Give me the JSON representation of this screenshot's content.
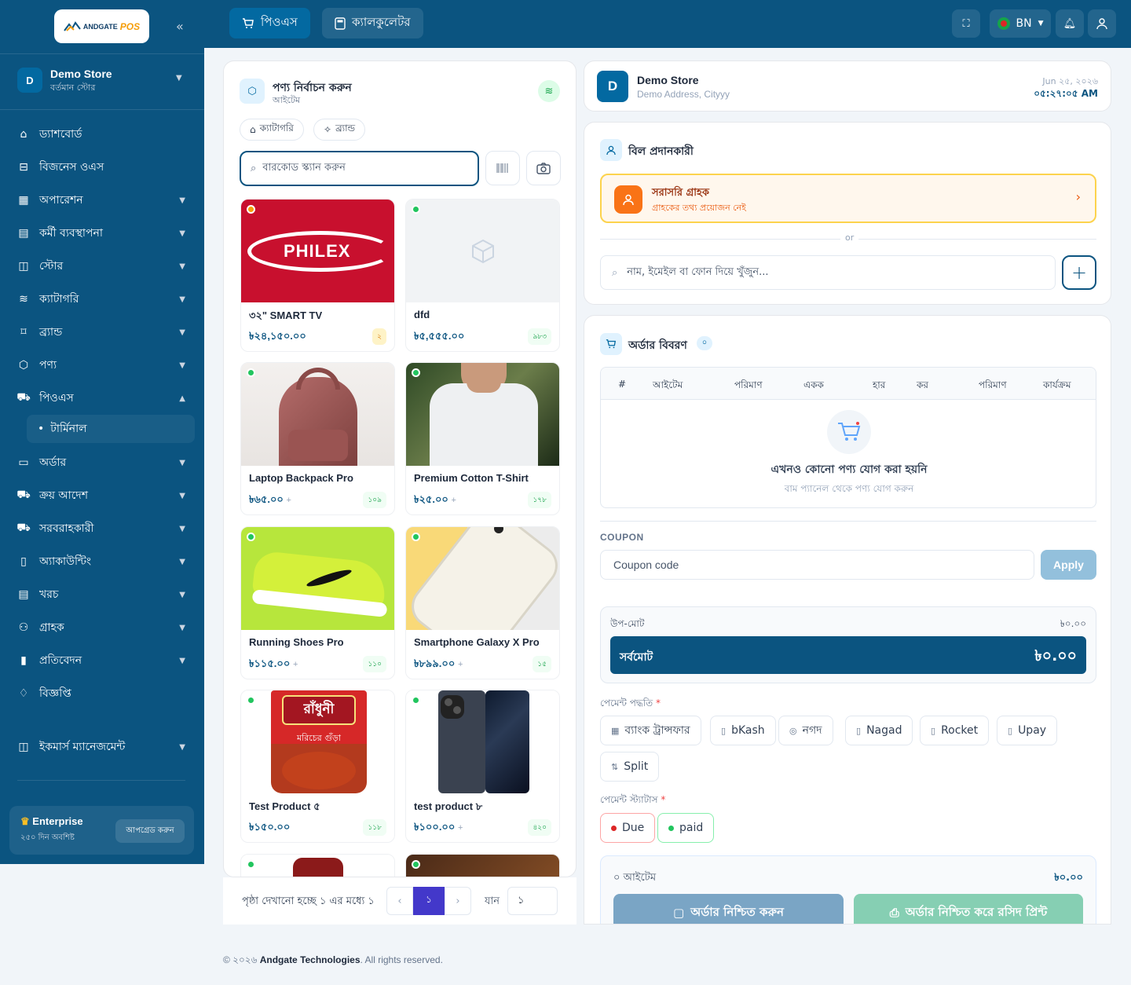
{
  "brand": {
    "logo_text": "ANDGATE",
    "logo_pos": "POS"
  },
  "store": {
    "avatar": "D",
    "name": "Demo Store",
    "sub": "বর্তমান স্টোর"
  },
  "nav": [
    {
      "label": "ড্যাশবোর্ড",
      "icon": "home-icon",
      "chev": false
    },
    {
      "label": "বিজনেস ওএস",
      "icon": "inbox-icon",
      "chev": false
    },
    {
      "label": "অপারেশন",
      "icon": "calculator-icon",
      "chev": true
    },
    {
      "label": "কর্মী ব্যবস্থাপনা",
      "icon": "calendar-icon",
      "chev": true
    },
    {
      "label": "স্টোর",
      "icon": "bag-icon",
      "chev": true
    },
    {
      "label": "ক্যাটাগরি",
      "icon": "layers-icon",
      "chev": true
    },
    {
      "label": "ব্র্যান্ড",
      "icon": "tag-icon",
      "chev": true
    },
    {
      "label": "পণ্য",
      "icon": "box-icon",
      "chev": true
    },
    {
      "label": "পিওএস",
      "icon": "cart-icon",
      "chev": true,
      "open": true
    },
    {
      "label": "টার্মিনাল",
      "sub": true
    },
    {
      "label": "অর্ডার",
      "icon": "document-icon",
      "chev": true
    },
    {
      "label": "ক্রয় আদেশ",
      "icon": "cart-icon",
      "chev": true
    },
    {
      "label": "সরবরাহকারী",
      "icon": "truck-icon",
      "chev": true
    },
    {
      "label": "অ্যাকাউন্টিং",
      "icon": "book-icon",
      "chev": true
    },
    {
      "label": "খরচ",
      "icon": "receipt-icon",
      "chev": true
    },
    {
      "label": "গ্রাহক",
      "icon": "users-icon",
      "chev": true
    },
    {
      "label": "প্রতিবেদন",
      "icon": "chart-icon",
      "chev": true
    },
    {
      "label": "বিজ্ঞপ্তি",
      "icon": "bell-icon",
      "chev": false
    },
    {
      "label": "ইকমার্স ম্যানেজমেন্ট",
      "icon": "bag-icon",
      "chev": true
    }
  ],
  "plan": {
    "title": "Enterprise",
    "sub": "২৫০ দিন অবশিষ্ট",
    "btn": "আপগ্রেড করুন"
  },
  "topbar": {
    "pos_btn": "পিওএস",
    "calc_btn": "ক্যালকুলেটর",
    "lang": "BN"
  },
  "product_panel": {
    "title": "পণ্য নির্বাচন করুন",
    "sub": "আইটেম",
    "filter_category": "ক্যাটাগরি",
    "filter_brand": "ব্র্যান্ড",
    "search_placeholder": "বারকোড স্ক্যান করুন"
  },
  "products": [
    {
      "name": "৩২\" SMART TV",
      "price": "৳২৪,১৫০.০০",
      "plus": "",
      "stock": "২",
      "dot": "#f59e0b",
      "stockwarn": true
    },
    {
      "name": "dfd",
      "price": "৳৫,৫৫৫.০০",
      "plus": "",
      "stock": "৯৮৩",
      "dot": "#22c55e"
    },
    {
      "name": "Laptop Backpack Pro",
      "price": "৳৬৫.০০",
      "plus": "+",
      "stock": "১০৯",
      "dot": "#22c55e"
    },
    {
      "name": "Premium Cotton T-Shirt",
      "price": "৳২৫.০০",
      "plus": "+",
      "stock": "১৭৮",
      "dot": "#22c55e"
    },
    {
      "name": "Running Shoes Pro",
      "price": "৳১১৫.০০",
      "plus": "+",
      "stock": "১১০",
      "dot": "#22c55e"
    },
    {
      "name": "Smartphone Galaxy X Pro",
      "price": "৳৮৯৯.০০",
      "plus": "+",
      "stock": "১৫",
      "dot": "#22c55e"
    },
    {
      "name": "Test Product ৫",
      "price": "৳১৫০.০০",
      "plus": "",
      "stock": "১১৮",
      "dot": "#22c55e"
    },
    {
      "name": "test product ৮",
      "price": "৳১০০.০০",
      "plus": "+",
      "stock": "৪২০",
      "dot": "#22c55e"
    }
  ],
  "image_text": {
    "philex": "PHILEX",
    "radhuni": "রাঁধুনী",
    "radhuni_sub": "মরিচের গুঁড়া"
  },
  "pagination": {
    "text": "পৃষ্ঠা দেখানো হচ্ছে ১ এর মধ্যে ১",
    "current": "১",
    "goto_label": "যান",
    "goto_value": "১"
  },
  "store_card": {
    "avatar": "D",
    "name": "Demo Store",
    "address": "Demo Address, Cityyy",
    "date": "Jun ২৫, ২০২৬",
    "time": "০৫:২৭:০৫ AM"
  },
  "customer": {
    "title": "বিল প্রদানকারী",
    "walkin_title": "সরাসরি গ্রাহক",
    "walkin_sub": "গ্রাহকের তথ্য প্রয়োজন নেই",
    "or": "or",
    "search_placeholder": "নাম, ইমেইল বা ফোন দিয়ে খুঁজুন..."
  },
  "order": {
    "title": "অর্ডার বিবরণ",
    "count": "০",
    "headers": [
      "#",
      "আইটেম",
      "পরিমাণ",
      "একক",
      "হার",
      "কর",
      "পরিমাণ",
      "কার্যক্রম"
    ],
    "empty_title": "এখনও কোনো পণ্য যোগ করা হয়নি",
    "empty_sub": "বাম প্যানেল থেকে পণ্য যোগ করুন"
  },
  "coupon": {
    "label": "COUPON",
    "placeholder": "Coupon code",
    "apply": "Apply"
  },
  "totals": {
    "subtotal_label": "উপ-মোট",
    "subtotal": "৳০.০০",
    "total_label": "সর্বমোট",
    "total": "৳০.০০"
  },
  "payment": {
    "method_label": "পেমেন্ট পদ্ধতি",
    "methods": [
      "ব্যাংক ট্রান্সফার",
      "bKash",
      "নগদ",
      "Nagad",
      "Rocket",
      "Upay",
      "Split"
    ],
    "status_label": "পেমেন্ট স্ট্যাটাস",
    "status": [
      "Due",
      "paid"
    ]
  },
  "summary": {
    "items": "০ আইটেম",
    "amount": "৳০.০০",
    "confirm": "অর্ডার নিশ্চিত করুন",
    "confirm_print": "অর্ডার নিশ্চিত করে রসিদ প্রিন্ট"
  },
  "footer": {
    "year": "© ২০২৬",
    "company": "Andgate Technologies",
    "rights": ". All rights reserved."
  },
  "colors": {
    "primary": "#0b5480",
    "accent": "#f97316",
    "success": "#22c55e"
  }
}
